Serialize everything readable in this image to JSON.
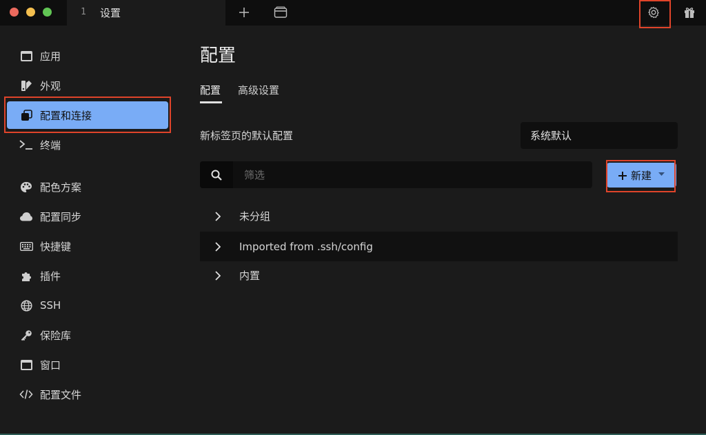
{
  "titlebar": {
    "tab_number": "1",
    "tab_title": "设置"
  },
  "sidebar": {
    "items": [
      {
        "label": "应用",
        "icon": "window-icon"
      },
      {
        "label": "外观",
        "icon": "palette-brush-icon"
      },
      {
        "label": "配置和连接",
        "icon": "profiles-icon",
        "active": true
      },
      {
        "label": "终端",
        "icon": "terminal-icon"
      },
      {
        "label": "配色方案",
        "icon": "palette-icon"
      },
      {
        "label": "配置同步",
        "icon": "cloud-icon"
      },
      {
        "label": "快捷键",
        "icon": "keyboard-icon"
      },
      {
        "label": "插件",
        "icon": "puzzle-icon"
      },
      {
        "label": "SSH",
        "icon": "globe-icon"
      },
      {
        "label": "保险库",
        "icon": "key-icon"
      },
      {
        "label": "窗口",
        "icon": "window-icon"
      },
      {
        "label": "配置文件",
        "icon": "code-icon"
      }
    ]
  },
  "main": {
    "title": "配置",
    "tabs": [
      "配置",
      "高级设置"
    ],
    "default_profile_label": "新标签页的默认配置",
    "default_profile_value": "系统默认",
    "filter_placeholder": "筛选",
    "new_button_label": "新建",
    "groups": [
      "未分组",
      "Imported from .ssh/config",
      "内置"
    ]
  },
  "colors": {
    "accent": "#79acf6",
    "highlight_border": "#e0442a",
    "background": "#1b1b1b",
    "titlebar": "#0e0e0e"
  }
}
